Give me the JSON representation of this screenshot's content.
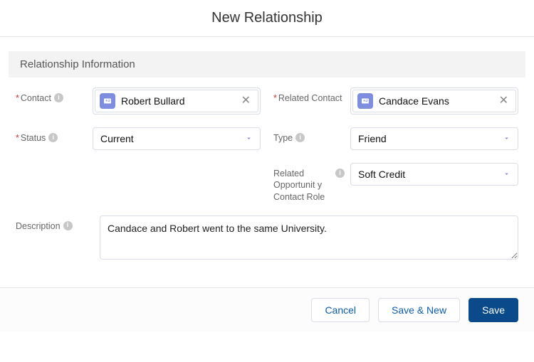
{
  "modal": {
    "title": "New Relationship"
  },
  "section": {
    "title": "Relationship Information"
  },
  "labels": {
    "contact": "Contact",
    "related_contact": "Related Contact",
    "status": "Status",
    "type": "Type",
    "related_opp_role": "Related Opportunit y Contact Role",
    "description": "Description"
  },
  "required": {
    "contact": "*",
    "related_contact": "*",
    "status": "*"
  },
  "values": {
    "contact": "Robert Bullard",
    "related_contact": "Candace Evans",
    "status": "Current",
    "type": "Friend",
    "related_opp_role": "Soft Credit",
    "description": "Candace and Robert went to the same University."
  },
  "icons": {
    "info_glyph": "i"
  },
  "footer": {
    "cancel": "Cancel",
    "save_new": "Save & New",
    "save": "Save"
  }
}
